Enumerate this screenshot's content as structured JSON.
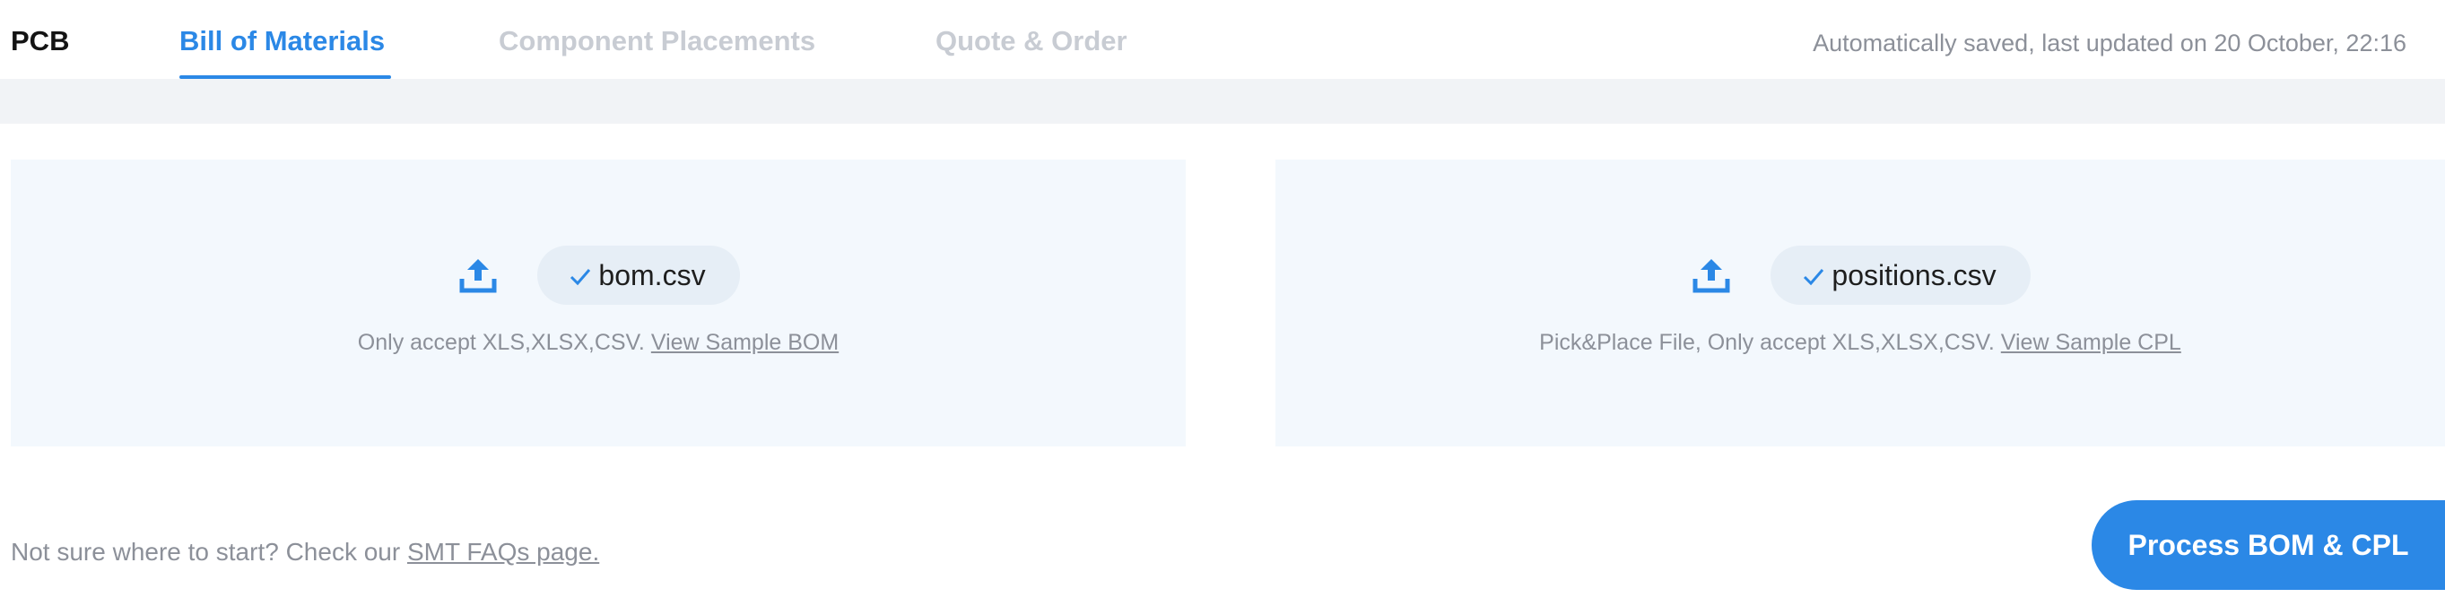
{
  "tabs": {
    "pcb": "PCB",
    "bom": "Bill of Materials",
    "cpl": "Component Placements",
    "quote": "Quote & Order",
    "active": "Bill of Materials"
  },
  "status": {
    "save_text": "Automatically saved, last updated on 20 October, 22:16"
  },
  "uploads": {
    "bom": {
      "file_name": "bom.csv",
      "hint": "Only accept XLS,XLSX,CSV.",
      "link": "View Sample BOM"
    },
    "cpl": {
      "file_name": "positions.csv",
      "hint": "Pick&Place File, Only accept XLS,XLSX,CSV.",
      "link": "View Sample CPL"
    }
  },
  "footer": {
    "help_text": "Not sure where to start? Check our",
    "help_link": "SMT FAQs page.",
    "process_button": "Process BOM & CPL"
  },
  "colors": {
    "accent": "#2b88e6",
    "panel_bg": "#f3f8fd",
    "chip_bg": "#e6eef6",
    "muted_text": "#8c9099",
    "inactive_tab": "#c8ccd3"
  },
  "icons": {
    "upload": "upload-icon",
    "check": "check-icon"
  }
}
